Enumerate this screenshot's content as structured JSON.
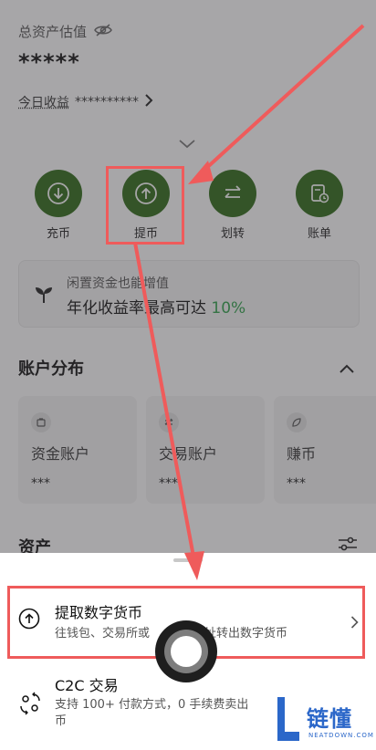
{
  "header": {
    "balance_label": "总资产估值",
    "balance_value": "*****",
    "today_label": "今日收益",
    "today_value": "**********"
  },
  "actions": [
    {
      "label": "充币",
      "icon": "download-icon"
    },
    {
      "label": "提币",
      "icon": "upload-icon"
    },
    {
      "label": "划转",
      "icon": "transfer-icon"
    },
    {
      "label": "账单",
      "icon": "bill-icon"
    }
  ],
  "promo": {
    "title": "闲置资金也能增值",
    "text": "年化收益率最高可达",
    "rate": "10%"
  },
  "distribution": {
    "title": "账户分布",
    "cards": [
      {
        "name": "资金账户",
        "value": "***"
      },
      {
        "name": "交易账户",
        "value": "***"
      },
      {
        "name": "赚币",
        "value": "***"
      }
    ]
  },
  "assets": {
    "title": "资产"
  },
  "sheet": {
    "options": [
      {
        "title": "提取数字货币",
        "desc": "往钱包、交易所或",
        "desc_tail": "址转出数字货币"
      },
      {
        "title": "C2C 交易",
        "desc_line1": "支持 100+ 付款方式，0 手续费卖出",
        "desc_line2": "币"
      }
    ]
  },
  "watermark": {
    "cn": "链懂",
    "en": "NEATDOWN.COM"
  },
  "colors": {
    "accent_green": "#2f6b17",
    "rate_green": "#2ea24a",
    "annotation_red": "#ef5b5b",
    "watermark_blue": "#2b67c9"
  }
}
